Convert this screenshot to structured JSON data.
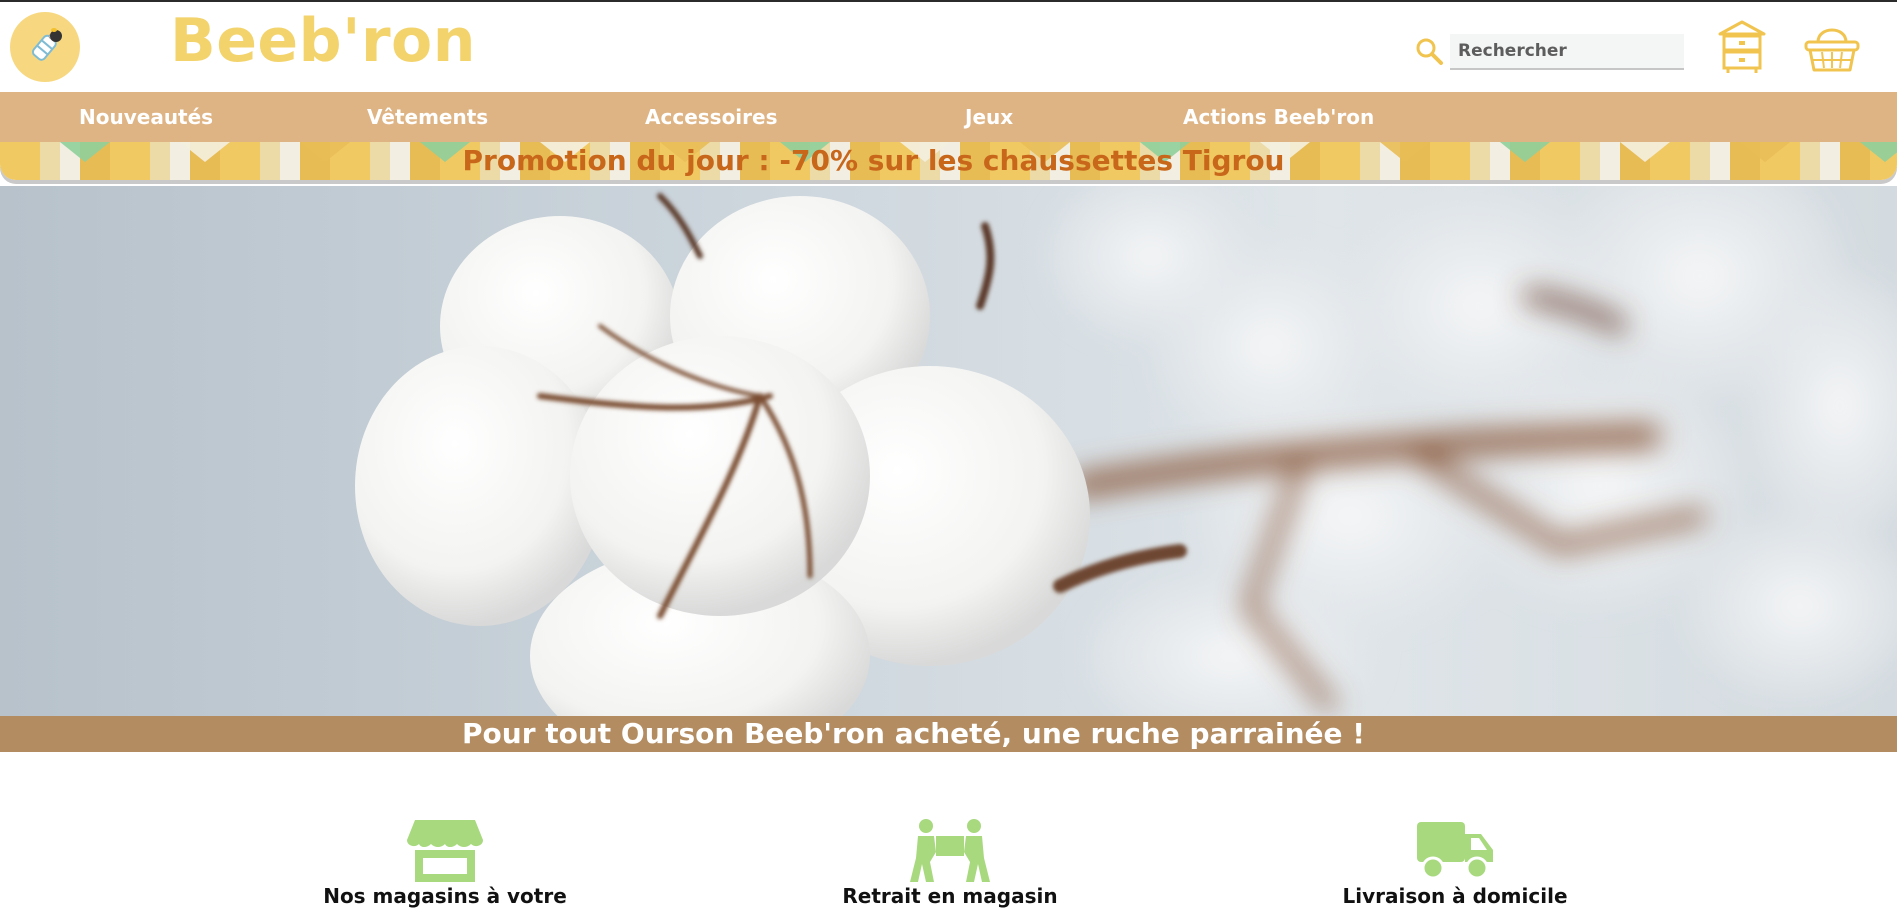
{
  "header": {
    "brand": "Beeb'ron",
    "search_placeholder": "Rechercher",
    "icons": [
      "bee-logo-icon",
      "search-icon",
      "beehive-icon",
      "basket-icon"
    ]
  },
  "nav": {
    "items": [
      "Nouveautés",
      "Vêtements",
      "Accessoires",
      "Jeux",
      "Actions Beeb'ron"
    ]
  },
  "promo": {
    "text": "Promotion du jour : -70% sur les chaussettes Tigrou"
  },
  "hero": {
    "tagline": "Pour tout Ourson Beeb'ron acheté, une ruche parrainée !"
  },
  "features": [
    {
      "label": "Nos magasins à votre",
      "icon": "storefront-icon"
    },
    {
      "label": "Retrait en magasin",
      "icon": "people-carrying-box-icon"
    },
    {
      "label": "Livraison à domicile",
      "icon": "delivery-truck-icon"
    }
  ],
  "colors": {
    "brand_yellow": "#f3d36c",
    "nav_tan": "#dfb484",
    "promo_orange": "#c8661a",
    "tagline_bg": "#b38c61",
    "feature_green": "#a8d97f"
  }
}
